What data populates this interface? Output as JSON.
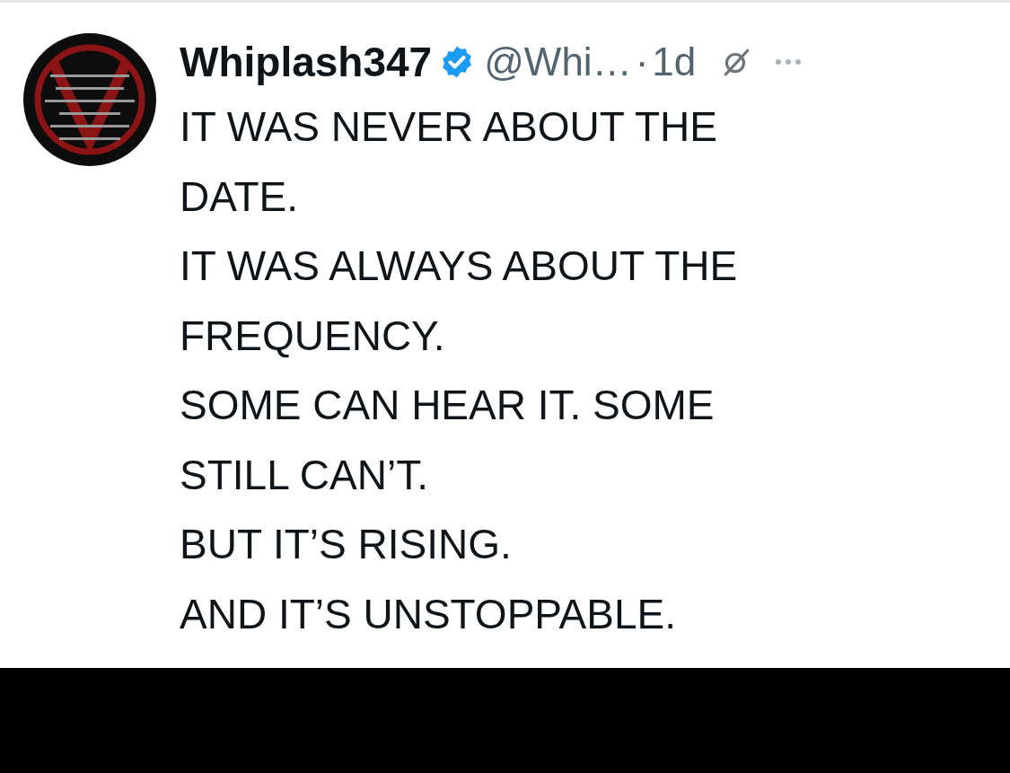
{
  "tweet": {
    "author": {
      "name": "Whiplash347",
      "verified": true,
      "handle": "@Whi…",
      "separator": "·",
      "time": "1d"
    },
    "text_lines": [
      "IT WAS NEVER ABOUT THE",
      "DATE.",
      "IT WAS ALWAYS ABOUT THE",
      "FREQUENCY.",
      "SOME CAN HEAR IT. SOME",
      "STILL CAN’T.",
      "BUT IT’S RISING.",
      "AND IT’S UNSTOPPABLE."
    ]
  }
}
